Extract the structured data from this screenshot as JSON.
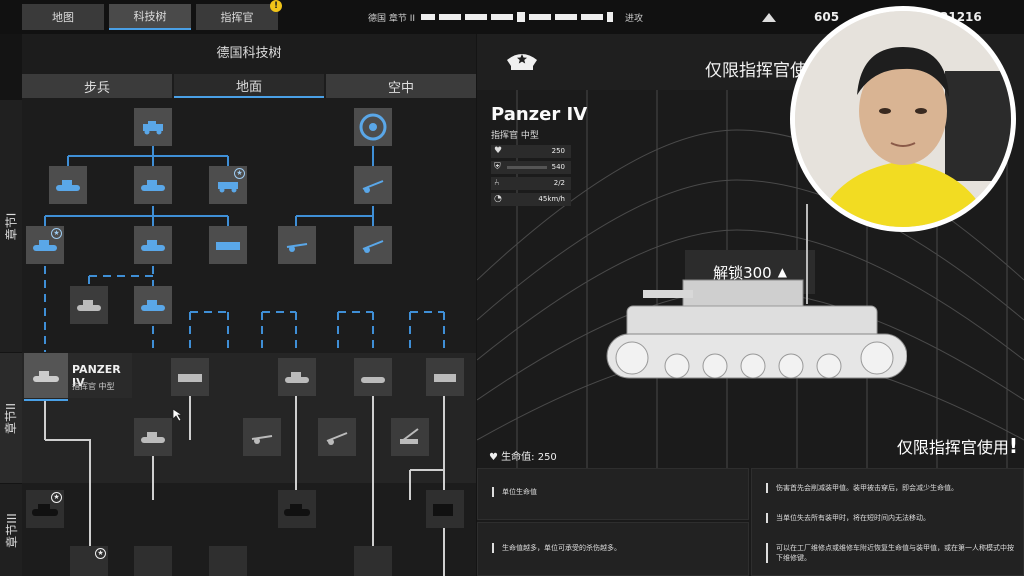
{
  "nav": {
    "map_label": "地图",
    "tech_label": "科技树",
    "commander_label": "指挥官",
    "commander_badge": "!"
  },
  "progress": {
    "chapter_label": "德国 章节 II",
    "end_label": "进攻"
  },
  "resources": {
    "funds": "605",
    "other": "21216"
  },
  "tree": {
    "title": "德国科技树",
    "tabs": [
      "步兵",
      "地面",
      "空中"
    ],
    "chapter_1": "章节I",
    "chapter_2": "章节II",
    "chapter_3": "章节III",
    "selected_name": "PANZER IV",
    "selected_sub": "指挥官 中型"
  },
  "detail": {
    "commander_only_title": "仅限指挥官使用",
    "unit_name": "Panzer IV",
    "unit_sub": "指挥官 中型",
    "stats": [
      {
        "icon": "heart-icon",
        "value": "250"
      },
      {
        "icon": "shield-icon",
        "value": "540"
      },
      {
        "icon": "seat-icon",
        "value": "2/2"
      },
      {
        "icon": "speed-icon",
        "value": "45km/h"
      }
    ],
    "unlock_label": "解锁300",
    "commander_only_note": "仅限指挥官使用",
    "health_label": "生命值: 250",
    "info_lines": [
      "单位生命值",
      "生命值越多，单位可承受的杀伤越多。",
      "伤害首先会削减装甲值。装甲被击穿后，即会减少生命值。",
      "当单位失去所有装甲时，将在短时间内无法移动。",
      "可以在工厂维修点或维修车附近恢复生命值与装甲值，或在第一人称模式中按下维修键。"
    ]
  },
  "colors": {
    "accent": "#4aa0e6",
    "node_icon": "#5aa7e8",
    "badge": "#f0c419"
  }
}
